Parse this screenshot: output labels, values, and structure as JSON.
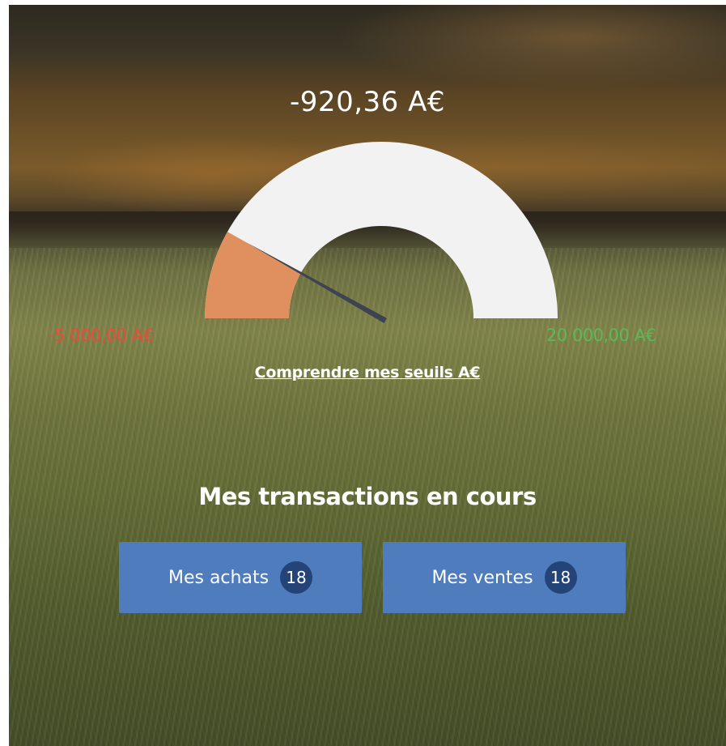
{
  "balance": {
    "amount": "-920,36 A€",
    "value": -920.36,
    "min_label": "-5 000,00 A€",
    "min_value": -5000,
    "max_label": "20 000,00 A€",
    "max_value": 20000,
    "fill_color": "#df905e",
    "track_color": "#f2f2f2",
    "needle_color": "#3d4350"
  },
  "thresholds_link": "Comprendre mes seuils A€",
  "transactions": {
    "title": "Mes transactions en cours",
    "purchases_label": "Mes achats",
    "purchases_count": "18",
    "sales_label": "Mes ventes",
    "sales_count": "18"
  }
}
